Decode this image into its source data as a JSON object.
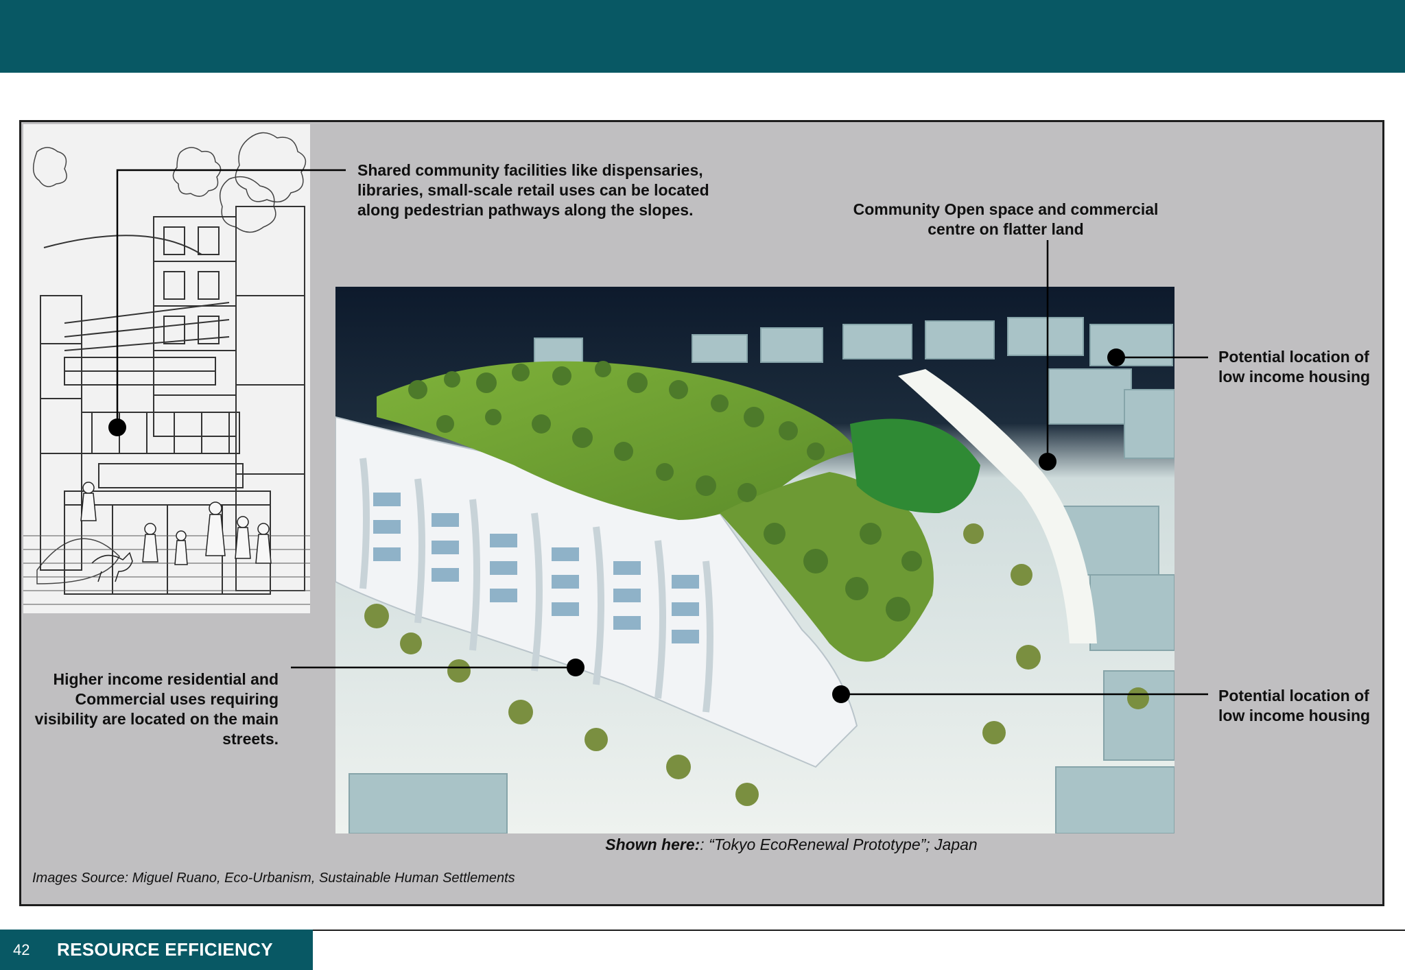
{
  "header": {},
  "annotations": {
    "shared_facilities": [
      "Shared community facilities like dispensaries,",
      "libraries, small-scale retail uses can be located",
      "along pedestrian pathways along the slopes."
    ],
    "community_open_space": [
      "Community Open space and commercial",
      "centre on flatter land"
    ],
    "low_income_housing_top": [
      "Potential location of",
      "low income housing"
    ],
    "low_income_housing_bottom": [
      "Potential location of",
      "low income housing"
    ],
    "higher_income": [
      "Higher income residential and",
      "Commercial uses requiring",
      "visibility are located on the main",
      "streets."
    ]
  },
  "caption": {
    "label": "Shown here:",
    "text": ": “Tokyo EcoRenewal Prototype”; Japan"
  },
  "source": "Images Source: Miguel Ruano, Eco-Urbanism, Sustainable Human Settlements",
  "footer": {
    "page_number": "42",
    "section": "RESOURCE EFFICIENCY"
  },
  "colors": {
    "brand_teal": "#085864",
    "panel_gray": "#c0bfc1",
    "callout_black": "#000000"
  },
  "images": {
    "sketch": "street-sketch-illustration",
    "photo": "eco-renewal-model-photo"
  }
}
